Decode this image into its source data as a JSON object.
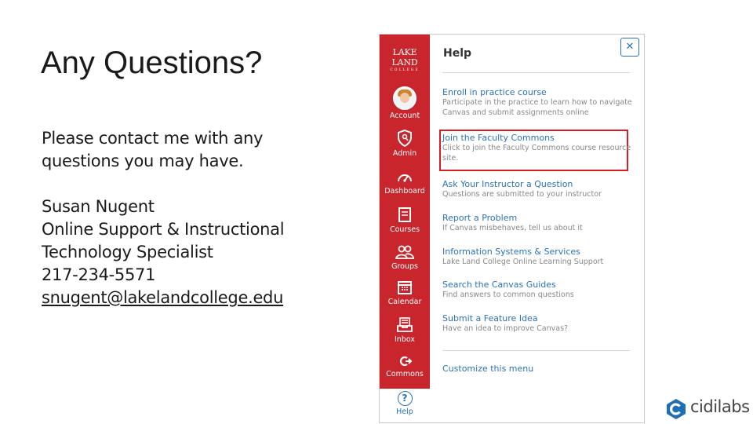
{
  "slide": {
    "title": "Any Questions?",
    "paragraph_line1": "Please contact me with any",
    "paragraph_line2": "questions you may have.",
    "contact_name": "Susan Nugent",
    "contact_role_line1": "Online Support & Instructional",
    "contact_role_line2": "Technology Specialist",
    "contact_phone": "217-234-5571",
    "contact_email": "snugent@lakelandcollege.edu"
  },
  "canvas": {
    "logo_main": "LAKE LAND",
    "logo_sub": "COLLEGE",
    "nav_color": "#c9252c",
    "nav": [
      {
        "label": "Account",
        "icon": "avatar-icon"
      },
      {
        "label": "Admin",
        "icon": "shield-icon"
      },
      {
        "label": "Dashboard",
        "icon": "dashboard-icon"
      },
      {
        "label": "Courses",
        "icon": "courses-icon"
      },
      {
        "label": "Groups",
        "icon": "groups-icon"
      },
      {
        "label": "Calendar",
        "icon": "calendar-icon"
      },
      {
        "label": "Inbox",
        "icon": "inbox-icon"
      },
      {
        "label": "Commons",
        "icon": "commons-icon"
      }
    ],
    "help_nav": {
      "label": "Help",
      "icon": "help-icon"
    },
    "tray": {
      "title": "Help",
      "close_icon": "close-icon",
      "items": [
        {
          "title": "Enroll in practice course",
          "desc1": "Participate in the practice to learn how to navigate",
          "desc2": "Canvas and submit assignments online"
        },
        {
          "title": "Join the Faculty Commons",
          "desc1": "Click to join the Faculty Commons course resource",
          "desc2": "site."
        },
        {
          "title": "Ask Your Instructor a Question",
          "desc1": "Questions are submitted to your instructor",
          "desc2": ""
        },
        {
          "title": "Report a Problem",
          "desc1": "If Canvas misbehaves, tell us about it",
          "desc2": ""
        },
        {
          "title": "Information Systems & Services",
          "desc1": "Lake Land College Online Learning Support",
          "desc2": ""
        },
        {
          "title": "Search the Canvas Guides",
          "desc1": "Find answers to common questions",
          "desc2": ""
        },
        {
          "title": "Submit a Feature Idea",
          "desc1": "Have an idea to improve Canvas?",
          "desc2": ""
        }
      ],
      "customize": "Customize this menu"
    }
  },
  "brand": {
    "name": "cidilabs",
    "icon": "cidilabs-logo-icon"
  }
}
